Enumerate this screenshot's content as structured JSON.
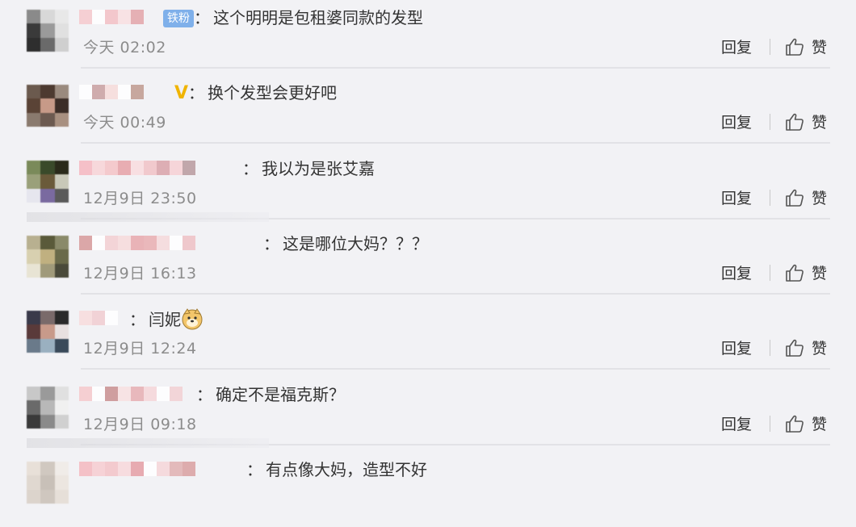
{
  "comments": [
    {
      "text": "这个明明是包租婆同款的发型",
      "badge": "铁粉",
      "time": "今天 02:02",
      "avatar": [
        "#8a8a8a",
        "#d8d8d8",
        "#e8e8e8",
        "#3a3a3a",
        "#9a9a9a",
        "#e0e0e0",
        "#2e2e2e",
        "#6a6a6a",
        "#cfcfcf"
      ],
      "name_colors": [
        "#f6c9cd",
        "#ffffff",
        "#f3c0c4",
        "#f9dfe1",
        "#e3a5a8"
      ]
    },
    {
      "text": "换个发型会更好吧",
      "vip": "V",
      "time": "今天 00:49",
      "avatar": [
        "#6b5a4e",
        "#4d3a30",
        "#9a8a7e",
        "#5a4336",
        "#c79a88",
        "#3b2d27",
        "#8a7a6e",
        "#6c5a50",
        "#a89080"
      ],
      "name_colors": [
        "#ffffff",
        "#c9a0a0",
        "#f7dcd9",
        "#ffffff",
        "#bf9a8e"
      ]
    },
    {
      "text": "我以为是张艾嘉",
      "time": "12月9日 23:50",
      "avatar": [
        "#7a8a5a",
        "#3a4a2a",
        "#2a2a1a",
        "#9aa07a",
        "#6a5a3a",
        "#c8c8b8",
        "#e6e6ee",
        "#7a6aa0",
        "#5a5a5a"
      ],
      "name_colors": [
        "#f6b7bf",
        "#f8d3d6",
        "#f4c3c6",
        "#e6a1a6",
        "#f9dcde",
        "#f1c2c5",
        "#d9a2a8",
        "#f7d0d3",
        "#b99a9e"
      ]
    },
    {
      "text": "这是哪位大妈？？？",
      "time": "12月9日 16:13",
      "avatar": [
        "#b8b090",
        "#5a5a3a",
        "#8a8a6a",
        "#d8d0b0",
        "#c0b080",
        "#6a6a4a",
        "#e8e4d4",
        "#a09a7a",
        "#4a4a3a"
      ],
      "name_colors": [
        "#d79a9a",
        "#ffffff",
        "#f3cfd1",
        "#f7dada",
        "#e8a8ac",
        "#e9aeb0",
        "#f6d9da",
        "#ffffff",
        "#eec1c4"
      ]
    },
    {
      "text": "闫妮",
      "time": "12月9日 12:24",
      "avatar": [
        "#3a3a4a",
        "#7a6a6a",
        "#2a2a2a",
        "#5a3a3a",
        "#c89a8a",
        "#e8e0e0",
        "#6a7a8a",
        "#9ab0c0",
        "#3a4a5a"
      ],
      "name_colors": [
        "#f8dcdc",
        "#f1cdd0",
        "#ffffff"
      ]
    },
    {
      "text": "确定不是福克斯？",
      "time": "12月9日 09:18",
      "avatar": [
        "#c8c8c8",
        "#9a9a9a",
        "#e0e0e0",
        "#6a6a6a",
        "#b8b8b8",
        "#f0f0f0",
        "#3a3a3a",
        "#8a8a8a",
        "#d0d0d0"
      ],
      "name_colors": [
        "#f6c9cb",
        "#ffffff",
        "#c98f8f",
        "#f8e0e1",
        "#e6aeb1",
        "#f6d6d8",
        "#ffffff",
        "#f2d0d2"
      ]
    },
    {
      "text": "有点像大妈，造型不好",
      "time": "",
      "avatar": [
        "#e8e0d8",
        "#d0c8c0",
        "#f0ece8",
        "#e0d8d0",
        "#c8c0b8",
        "#ece6e0",
        "#dcd4cc",
        "#cfc7bf",
        "#e6dfd8"
      ],
      "name_colors": [
        "#f4b8be",
        "#f7ccd0",
        "#f3c3c7",
        "#f8d8da",
        "#e59fa4",
        "#ffffff",
        "#f6d6d8",
        "#e0b0b0",
        "#d9a0a0"
      ]
    }
  ],
  "actions": {
    "reply": "回复",
    "like": "赞"
  },
  "colors": {
    "background": "#f2f2f5",
    "badge": "#7fb0ea",
    "vip": "#f0b400"
  }
}
